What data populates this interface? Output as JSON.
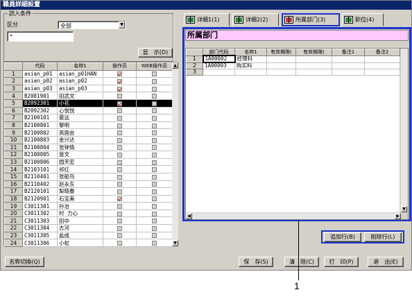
{
  "window": {
    "title": "職員詳細設置"
  },
  "conditions": {
    "group_label": "読入条件",
    "category_label": "区分",
    "category_value": "全部",
    "filter_value": "*",
    "display_button": "显　示(D)"
  },
  "left_grid": {
    "headers": [
      "",
      "代码",
      "名称1",
      "操作员",
      "WEB操作员"
    ],
    "rows": [
      {
        "n": "1",
        "code": "asian_p01",
        "name": "asian_p01HAN",
        "op": true,
        "web": false
      },
      {
        "n": "2",
        "code": "asian_p02",
        "name": "asian_p02",
        "op": true,
        "web": false
      },
      {
        "n": "3",
        "code": "asian_p03",
        "name": "asian_p03",
        "op": true,
        "web": false
      },
      {
        "n": "4",
        "code": "B2081901",
        "name": "田武文",
        "op": false,
        "web": false
      },
      {
        "n": "5",
        "code": "B2092301",
        "name": "小花",
        "op": true,
        "web": false,
        "selected": true
      },
      {
        "n": "6",
        "code": "B2092302",
        "name": "心悦悦",
        "op": false,
        "web": false
      },
      {
        "n": "7",
        "code": "B2100101",
        "name": "曼远",
        "op": false,
        "web": false
      },
      {
        "n": "8",
        "code": "B2100801",
        "name": "黎明",
        "op": false,
        "web": false
      },
      {
        "n": "9",
        "code": "B2100802",
        "name": "高国会",
        "op": false,
        "web": false
      },
      {
        "n": "10",
        "code": "B2100803",
        "name": "金兴达",
        "op": false,
        "web": false
      },
      {
        "n": "11",
        "code": "B2100804",
        "name": "张钟情",
        "op": false,
        "web": false
      },
      {
        "n": "12",
        "code": "B2100805",
        "name": "皆文",
        "op": false,
        "web": false
      },
      {
        "n": "13",
        "code": "B2100806",
        "name": "园天宏",
        "op": false,
        "web": false
      },
      {
        "n": "14",
        "code": "B2103101",
        "name": "祁红",
        "op": false,
        "web": false
      },
      {
        "n": "15",
        "code": "B2110401",
        "name": "张船鸟",
        "op": false,
        "web": false
      },
      {
        "n": "16",
        "code": "B2110402",
        "name": "赵永东",
        "op": false,
        "web": false
      },
      {
        "n": "17",
        "code": "B2120101",
        "name": "梨晓春",
        "op": false,
        "web": false
      },
      {
        "n": "18",
        "code": "B2120901",
        "name": "石宝美",
        "op": true,
        "web": false
      },
      {
        "n": "19",
        "code": "C3011301",
        "name": "孙治",
        "op": false,
        "web": false
      },
      {
        "n": "20",
        "code": "C3011302",
        "name": "时 力心",
        "op": false,
        "web": false
      },
      {
        "n": "21",
        "code": "C3011303",
        "name": "田中",
        "op": false,
        "web": false
      },
      {
        "n": "22",
        "code": "C3011304",
        "name": "古河",
        "op": false,
        "web": false
      },
      {
        "n": "23",
        "code": "C3011305",
        "name": "盐成",
        "op": false,
        "web": false
      },
      {
        "n": "24",
        "code": "C3011306",
        "name": "小松",
        "op": false,
        "web": false
      }
    ]
  },
  "tabs": [
    {
      "label": "详细1(1)",
      "active": false,
      "icon": "book-icon"
    },
    {
      "label": "详细2(2)",
      "active": false,
      "icon": "notebook-icon"
    },
    {
      "label": "所属部门(3)",
      "active": true,
      "icon": "department-icon"
    },
    {
      "label": "职位(4)",
      "active": false,
      "icon": "book-icon"
    }
  ],
  "dept": {
    "section_title": "所属部门",
    "headers": [
      "",
      "部门代码",
      "名称1",
      "有效期限(",
      "有效期限(",
      "备注1",
      "备注2"
    ],
    "rows": [
      {
        "n": "1",
        "code": "1A00002",
        "name": "经理科"
      },
      {
        "n": "2",
        "code": "1A00003",
        "name": "购买科"
      },
      {
        "n": "3",
        "code": "",
        "name": ""
      }
    ],
    "add_row": "追加行(B)",
    "delete_row": "削除行(L)"
  },
  "bottom": {
    "name_switch": "名称切換(Q)",
    "save": "保　存(S)",
    "clear": "清　除(C)",
    "print": "打　印(P)",
    "exit": "退　出(E)"
  },
  "callout": {
    "label": "1"
  },
  "colors": {
    "highlight": "#1a35c8",
    "section_bg": "#ffc8ff",
    "title_bar": "#0a246a"
  }
}
